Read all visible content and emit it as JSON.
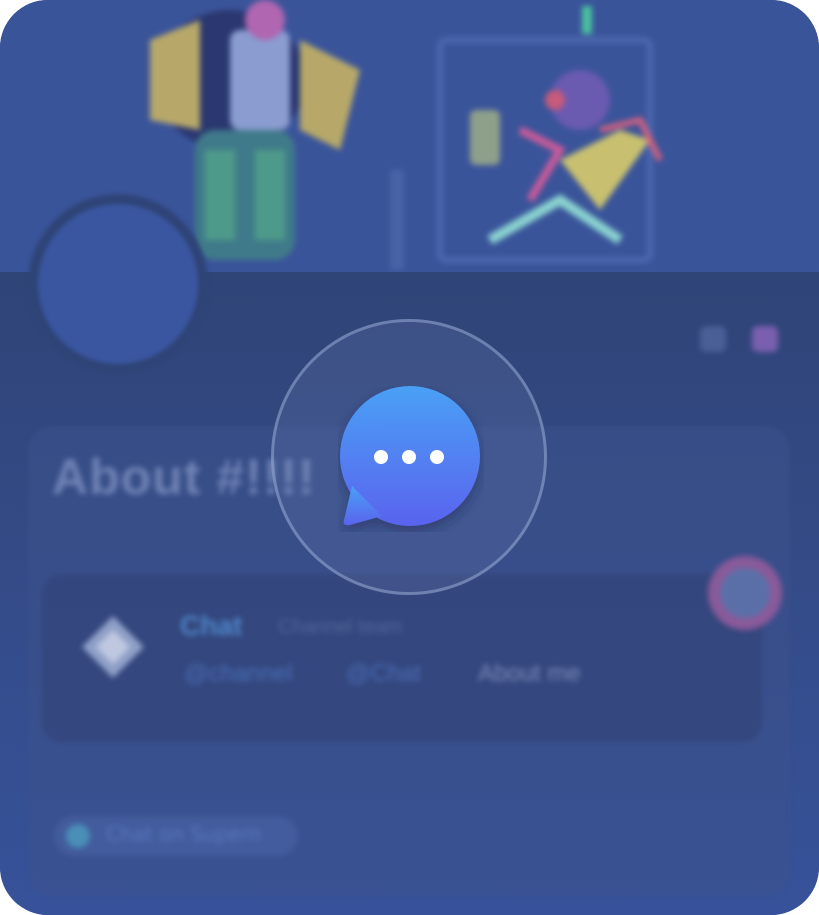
{
  "profile": {
    "about_title": "About #!!!!",
    "member": {
      "name": "Chat",
      "subtitle": "Channel team",
      "links": [
        "@channel",
        "@Chat",
        "About me"
      ]
    },
    "status_pill": "Chat on Supern"
  },
  "overlay": {
    "icon": "chat-bubble-ellipsis-icon",
    "state": "loading"
  },
  "colors": {
    "background": "#354d8c",
    "icon_gradient_top": "#4aa0f5",
    "icon_gradient_bottom": "#5a63ee"
  }
}
